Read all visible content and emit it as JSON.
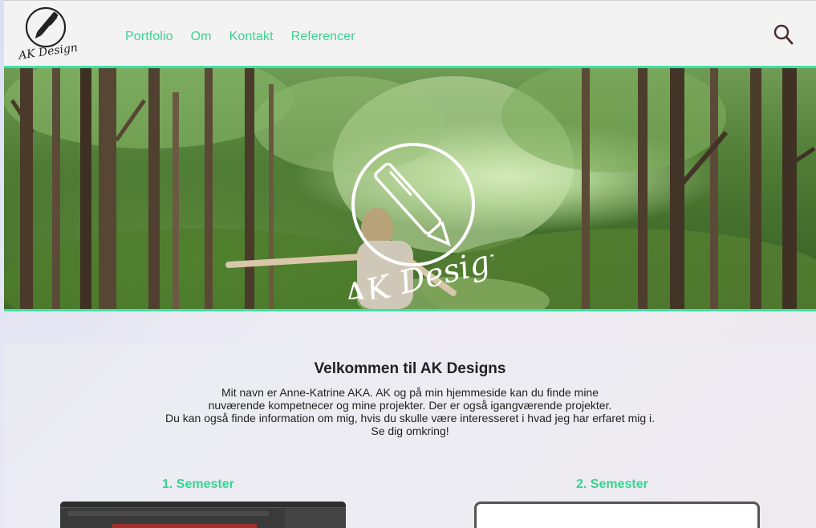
{
  "header": {
    "logo_text": "AK Designs",
    "nav": [
      "Portfolio",
      "Om",
      "Kontakt",
      "Referencer"
    ]
  },
  "hero": {
    "logo_text": "AK Designs"
  },
  "welcome": {
    "title": "Velkommen til AK Designs",
    "lines": [
      "Mit navn er Anne-Katrine AKA. AK og på min hjemmeside kan du finde mine",
      "nuværende kompetnecer og mine projekter. Der er også igangværende projekter.",
      "Du kan også finde information om mig, hvis du skulle være interesseret i hvad jeg har erfaret mig i.",
      "Se dig omkring!"
    ]
  },
  "semesters": [
    {
      "title": "1. Semester"
    },
    {
      "title": "2. Semester"
    }
  ],
  "colors": {
    "accent": "#3bd391",
    "accent_line": "#3ee0a6"
  },
  "icons": {
    "logo": "pen-circle-logo",
    "search": "search-icon"
  }
}
